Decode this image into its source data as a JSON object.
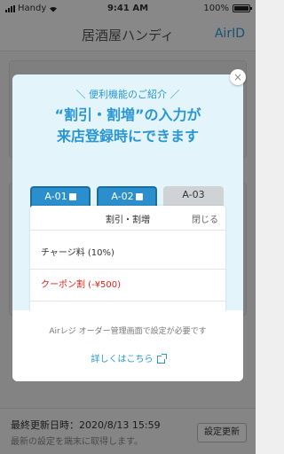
{
  "status_bar": {
    "carrier": "Handy",
    "time": "9:41 AM",
    "battery": "100%"
  },
  "header": {
    "title": "居酒屋ハンディ",
    "right_link": "AirID"
  },
  "footer": {
    "last_updated": "最終更新日時：2020/8/13 15:59",
    "hint": "最新の設定を端末に取得します。",
    "refresh_button": "設定更新"
  },
  "modal": {
    "close_glyph": "×",
    "intro": "＼ 便利機能のご紹介 ／",
    "headline_line1": "“割引・割増”の入力が",
    "headline_line2": "来店登録時にできます",
    "tabs": [
      {
        "label": "A-01",
        "active": true
      },
      {
        "label": "A-02",
        "active": true
      },
      {
        "label": "A-03",
        "active": false
      }
    ],
    "panel": {
      "title": "割引・割増",
      "close_label": "閉じる",
      "rows": [
        {
          "label": "チャージ料 (10%)",
          "color": "#333333"
        },
        {
          "label": "クーポン割 (-¥500)",
          "color": "#e2231a"
        }
      ]
    },
    "note": "Airレジ オーダー管理画面で設定が必要です",
    "link_label": "詳しくはこちら"
  },
  "colors": {
    "accent": "#2a97d4",
    "discount_red": "#e2231a"
  }
}
